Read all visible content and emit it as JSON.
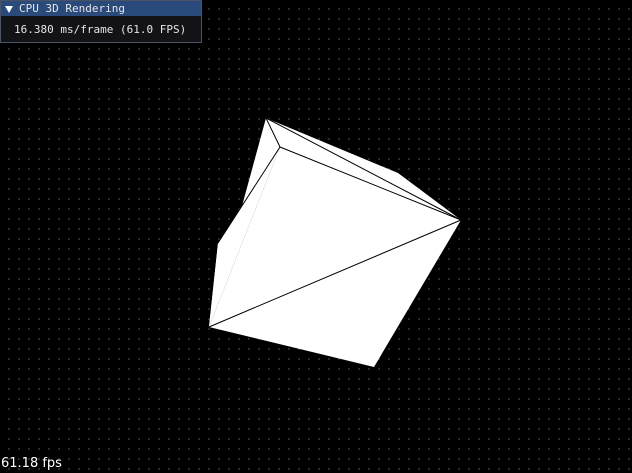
{
  "window": {
    "title": "CPU 3D Rendering",
    "frame_time": "16.380 ms/frame (61.0 FPS)",
    "collapse_icon": "triangle-down-icon"
  },
  "overlay": {
    "fps": "61.18 fps"
  },
  "scene": {
    "background_color": "#000000",
    "grid_dot_color": "#3a3a3a",
    "mesh_fill_color": "#ffffff",
    "mesh_edge_color": "#000000"
  }
}
